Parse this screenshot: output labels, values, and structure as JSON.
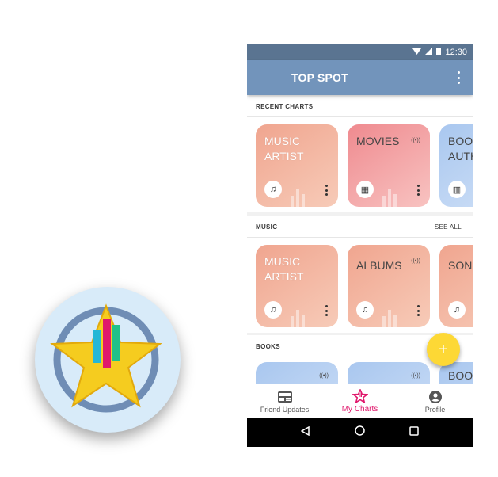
{
  "status_bar": {
    "time": "12:30"
  },
  "app_bar": {
    "title": "TOP SPOT"
  },
  "sections": {
    "recent": {
      "title": "RECENT CHARTS",
      "cards": [
        {
          "label": "MUSIC ARTIST",
          "type_icon": "music-note-icon"
        },
        {
          "label": "MOVIES",
          "type_icon": "film-icon",
          "live": true
        },
        {
          "label": "BOOK AUTH",
          "type_icon": "book-icon"
        }
      ]
    },
    "music": {
      "title": "MUSIC",
      "see_all": "SEE ALL",
      "cards": [
        {
          "label": "MUSIC ARTIST",
          "type_icon": "music-note-icon"
        },
        {
          "label": "ALBUMS",
          "type_icon": "music-note-icon",
          "live": true
        },
        {
          "label": "SONG",
          "type_icon": "music-note-icon"
        }
      ]
    },
    "books": {
      "title": "BOOKS",
      "cards": [
        {
          "label": ""
        },
        {
          "label": ""
        },
        {
          "label": "BOOK"
        }
      ]
    }
  },
  "fab": {
    "label": "+"
  },
  "bottom_nav": {
    "items": [
      {
        "label": "Friend Updates",
        "icon": "news-feed-icon"
      },
      {
        "label": "My Charts",
        "icon": "star-chart-icon",
        "active": true
      },
      {
        "label": "Profile",
        "icon": "account-circle-icon"
      }
    ]
  },
  "colors": {
    "app_bar": "#7294bb",
    "status_bar": "#5a7491",
    "accent": "#e0186c",
    "fab": "#fdd835",
    "card_peach": "#f0a58f",
    "card_pink": "#ef8a8f",
    "card_blue": "#a9c7ef"
  }
}
